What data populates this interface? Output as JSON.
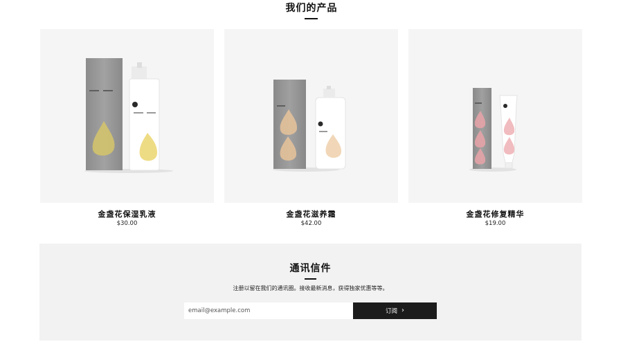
{
  "section_title": "我们的产品",
  "products": [
    {
      "name": "金盏花保湿乳液",
      "price": "$30.00"
    },
    {
      "name": "金盏花滋养霜",
      "price": "$42.00"
    },
    {
      "name": "金盏花修复精华",
      "price": "$19.00"
    }
  ],
  "newsletter": {
    "title": "通讯信件",
    "description": "注册以留在我们的通讯圈。接收最新消息，获得独家优惠等等。",
    "email_placeholder": "email@example.com",
    "submit_label": "订阅"
  },
  "colors": {
    "card_bg": "#f5f5f5",
    "newsletter_bg": "#f2f2f2",
    "button_bg": "#1c1c1c"
  }
}
